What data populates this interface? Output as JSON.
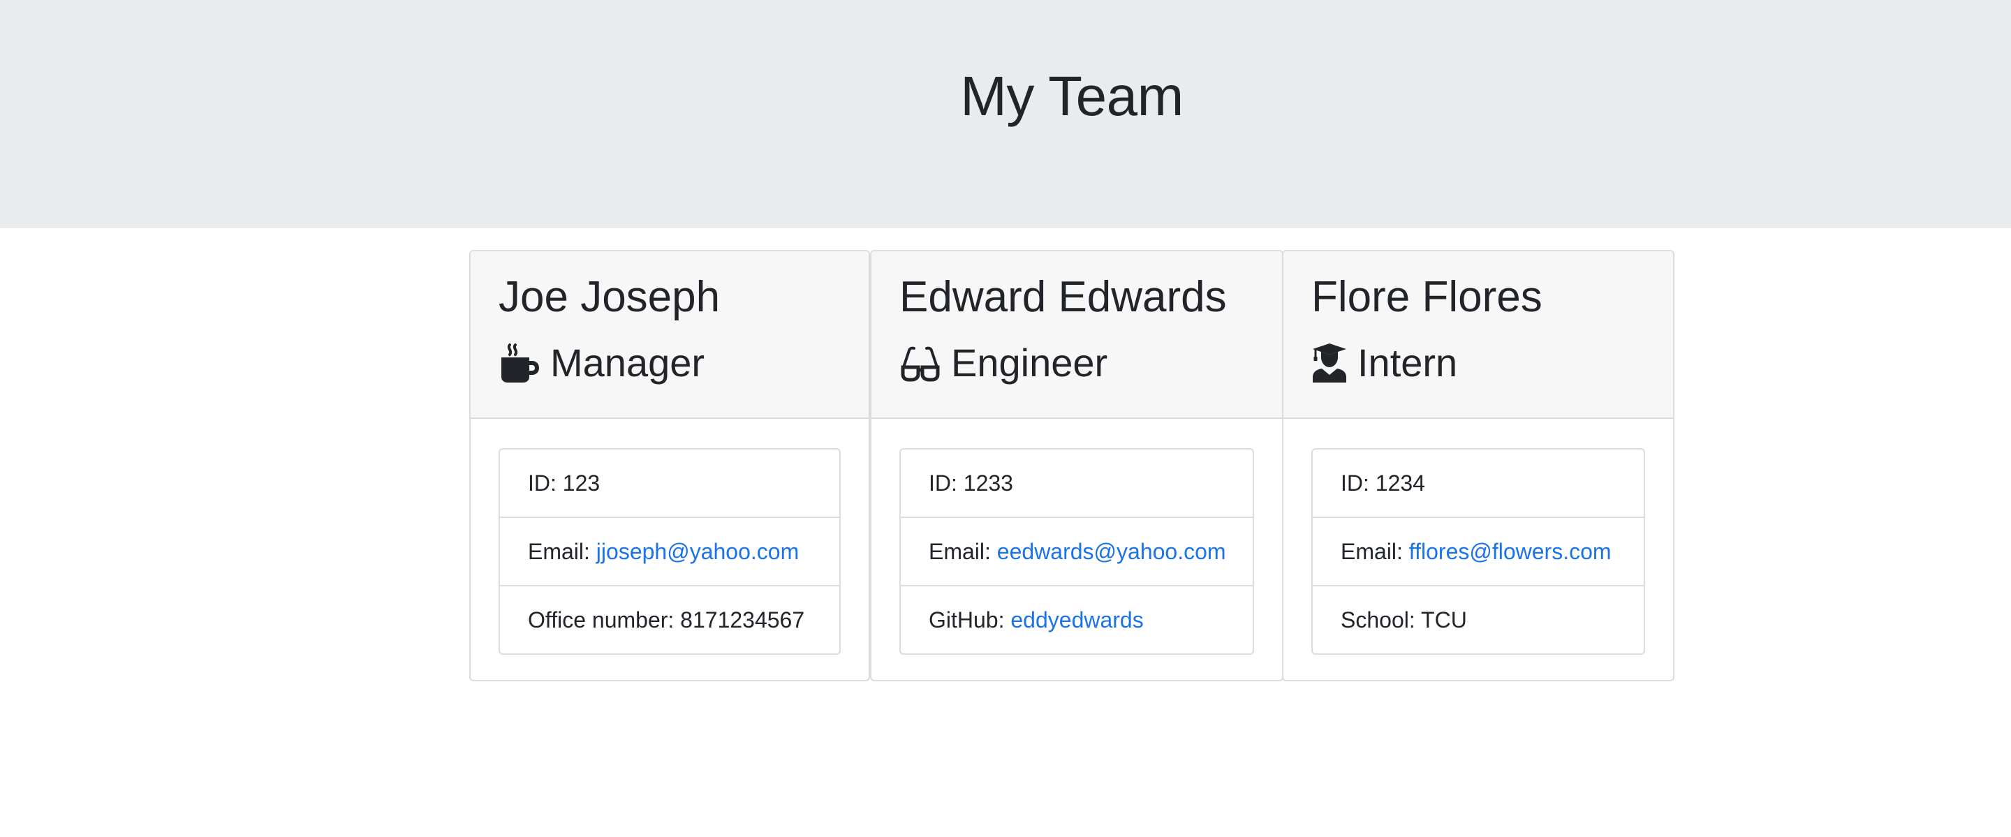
{
  "header": {
    "title": "My Team"
  },
  "colors": {
    "jumbotron_bg": "#e9ecef",
    "card_header_bg": "#f7f7f7",
    "link": "#1a73e8",
    "text": "#212529"
  },
  "employees": [
    {
      "name": "Joe Joseph",
      "role": "Manager",
      "icon": "coffee-mug-icon",
      "id_label": "ID: 123",
      "email_prefix": "Email: ",
      "email": "jjoseph@yahoo.com",
      "extra_label": "Office number: 8171234567"
    },
    {
      "name": "Edward Edwards",
      "role": "Engineer",
      "icon": "glasses-icon",
      "id_label": "ID: 1233",
      "email_prefix": "Email: ",
      "email": "eedwards@yahoo.com",
      "extra_prefix": "GitHub: ",
      "extra_link": "eddyedwards"
    },
    {
      "name": "Flore Flores",
      "role": "Intern",
      "icon": "graduate-icon",
      "id_label": "ID: 1234",
      "email_prefix": "Email: ",
      "email": "fflores@flowers.com",
      "extra_label": "School: TCU"
    }
  ]
}
